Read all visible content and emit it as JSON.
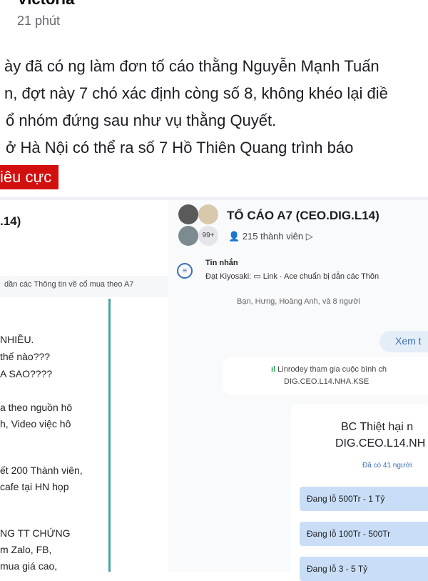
{
  "post": {
    "author": "Victoria",
    "time": "21 phút",
    "lines": [
      "ày đã có ng làm đơn tố cáo thằng Nguyễn Mạnh Tuấn",
      "n, đợt này 7 chó xác định còng số 8, không khéo lại điề",
      "ổ nhóm đứng sau như vụ thằng Quyết.",
      " ở Hà Nội có thể ra số 7 Hồ Thiên Quang trình báo"
    ],
    "tag": "iêu cực"
  },
  "left_panel": {
    "header": ".14)",
    "subheader": "dần các Thông tin về cổ mua theo A7",
    "lines": [
      "NHIỀU.",
      "thế nào???",
      "A SAO????",
      "a theo nguồn hô",
      "h, Video việc hô",
      "ết 200 Thành viên,",
      "cafe tại HN họp",
      "NG TT CHỨNG",
      "m Zalo, FB,",
      " mua giá cao,"
    ]
  },
  "group": {
    "name": "TỐ CÁO A7 (CEO.DIG.L14)",
    "avatar_badge": "99+",
    "members": "215 thành viên",
    "message_title": "Tin nhắn",
    "message_preview": "Đạt Kiyosaki: ▭ Link · Ace chuẩn bị dẫn các Thôn",
    "readers": "Bạn, Hưng, Hoàng Anh, và 8 người",
    "see_more": "Xem t",
    "poll_join_1": "Linrodey tham gia cuộc bình ch",
    "poll_join_2": "DIG.CEO.L14.NHA.KSE",
    "poll_title_1": "BC Thiệt hại n",
    "poll_title_2": "DIG.CEO.L14.NH",
    "poll_voted": "Đã có 41 người",
    "options": [
      "Đang lỗ 500Tr - 1 Tỷ",
      "Đang lỗ 100Tr - 500Tr",
      "Đang lỗ 3 - 5 Tỷ"
    ]
  },
  "colors": {
    "tag_bg": "#d20f0f",
    "accent": "#3b6fb6",
    "option_bg": "#c9def6"
  }
}
